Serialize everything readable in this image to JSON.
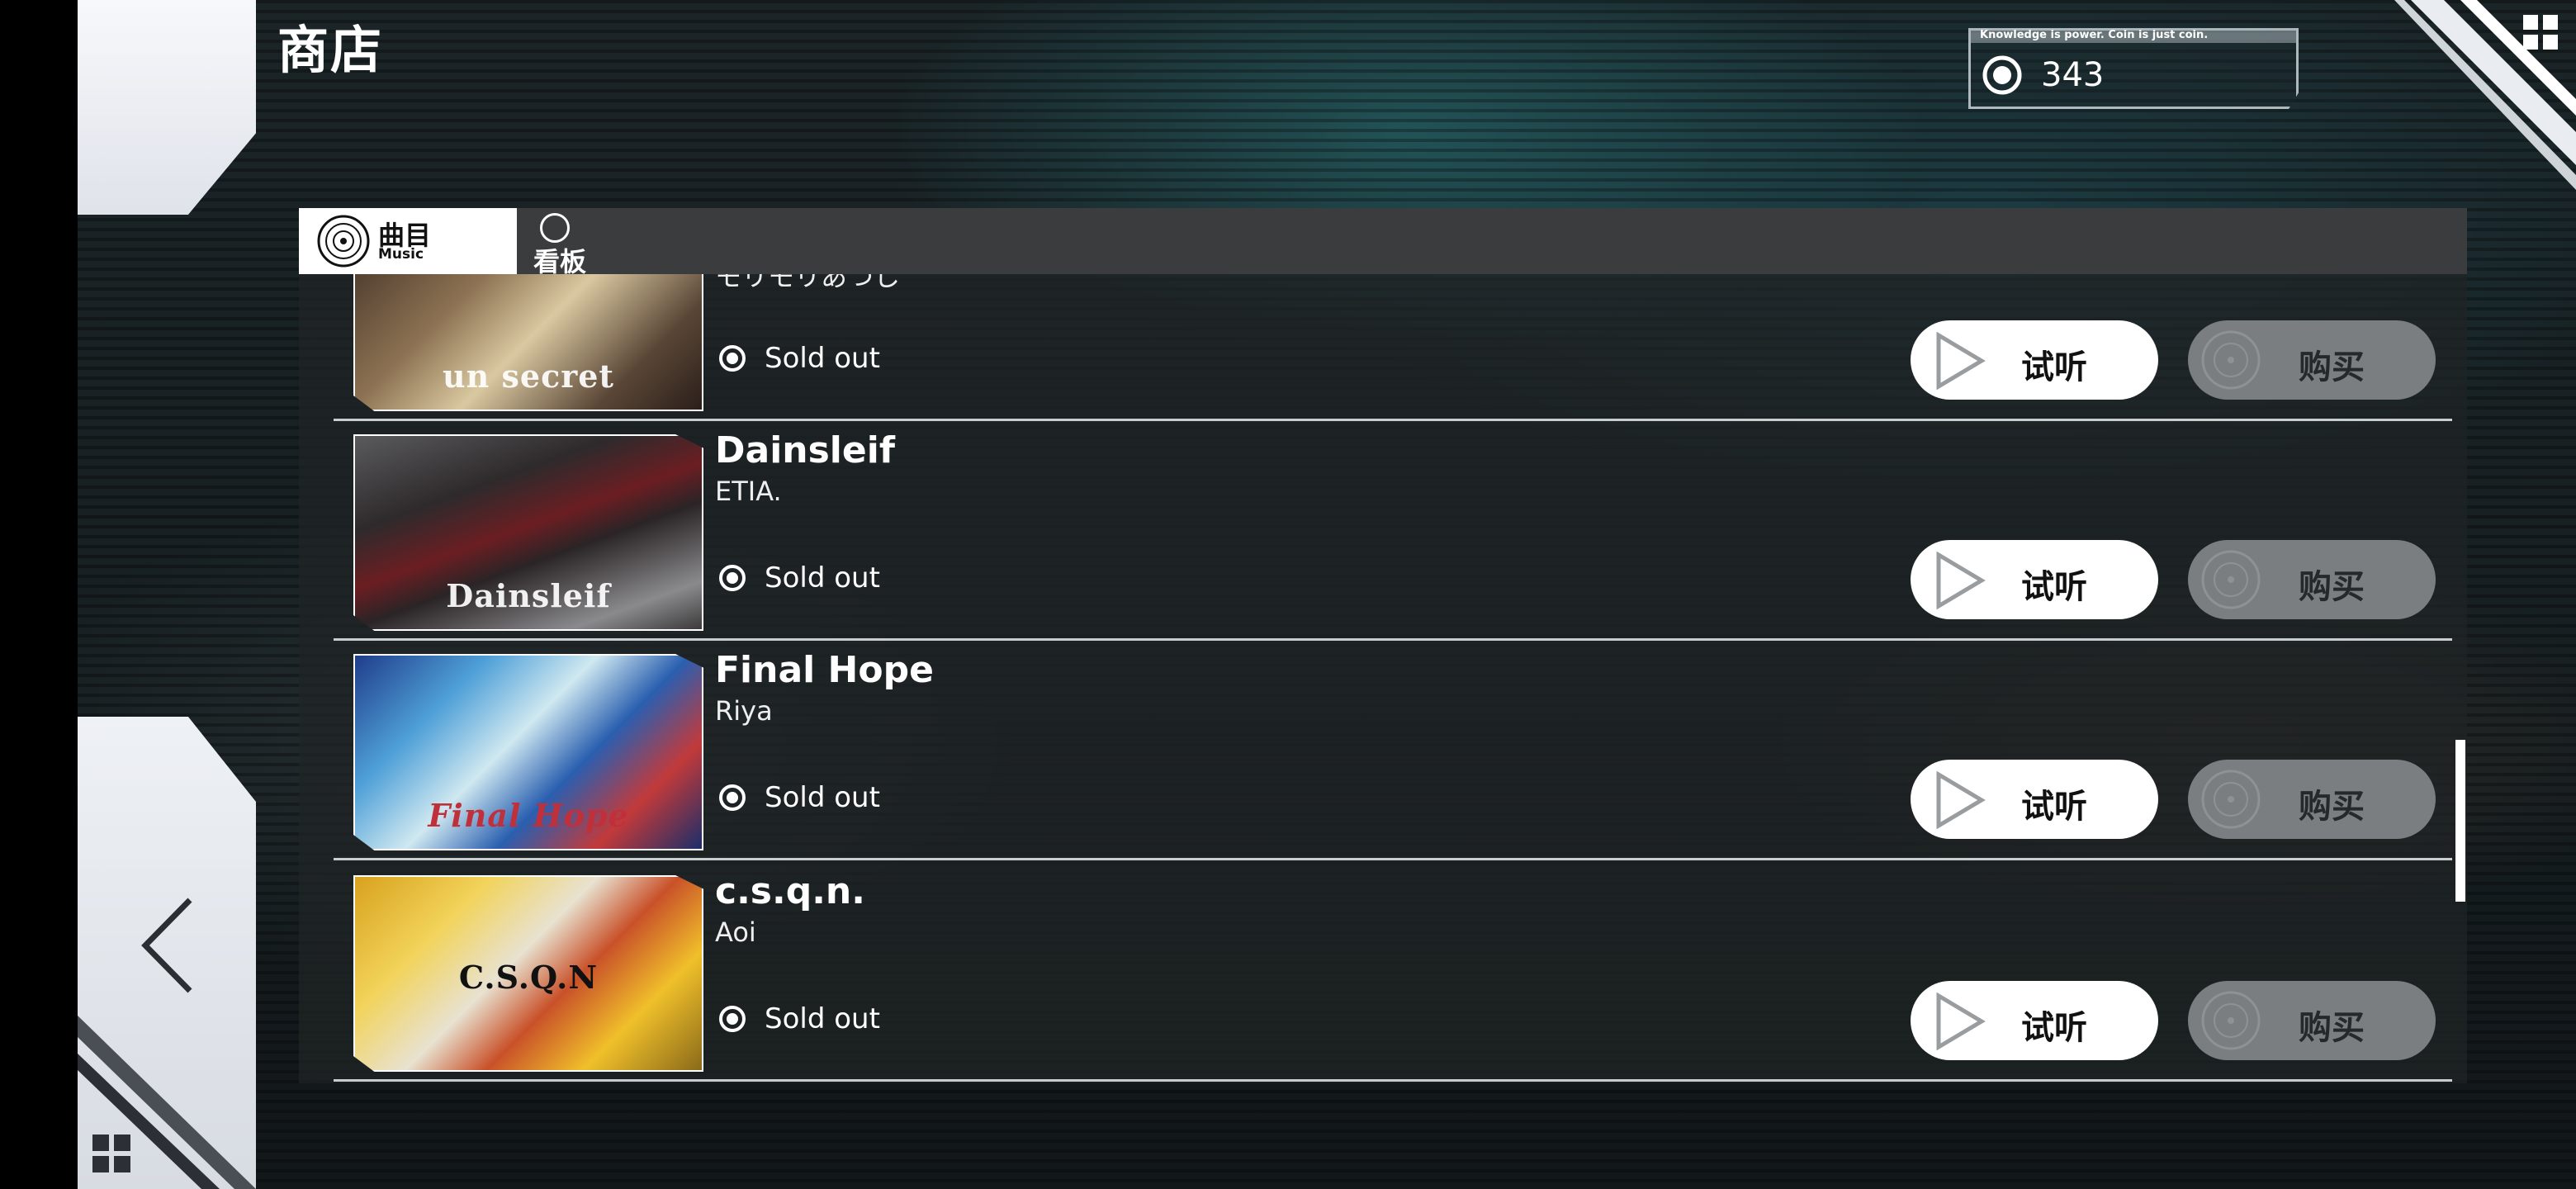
{
  "header": {
    "title": "商店"
  },
  "coins": {
    "tagline": "Knowledge is power. Coin is just coin.",
    "value": "343"
  },
  "tabs": {
    "music": {
      "label": "曲目",
      "sub": "Music"
    },
    "board": {
      "label": "看板"
    }
  },
  "songs": [
    {
      "title": "",
      "artist": "モリモリあつし",
      "cover_text": "un secret",
      "status": "Sold out",
      "preview_label": "试听",
      "buy_label": "购买"
    },
    {
      "title": "Dainsleif",
      "artist": "ETIA.",
      "cover_text": "Dainsleif",
      "status": "Sold out",
      "preview_label": "试听",
      "buy_label": "购买"
    },
    {
      "title": "Final Hope",
      "artist": "Riya",
      "cover_text": "Final Hope",
      "status": "Sold out",
      "preview_label": "试听",
      "buy_label": "购买"
    },
    {
      "title": "c.s.q.n.",
      "artist": "Aoi",
      "cover_text": "C.S.Q.N",
      "status": "Sold out",
      "preview_label": "试听",
      "buy_label": "购买"
    }
  ],
  "icons": {
    "back": "chevron-left-icon",
    "menu": "grid-menu-icon",
    "coin": "coin-icon",
    "preview": "play-icon",
    "buy": "coin-icon"
  }
}
